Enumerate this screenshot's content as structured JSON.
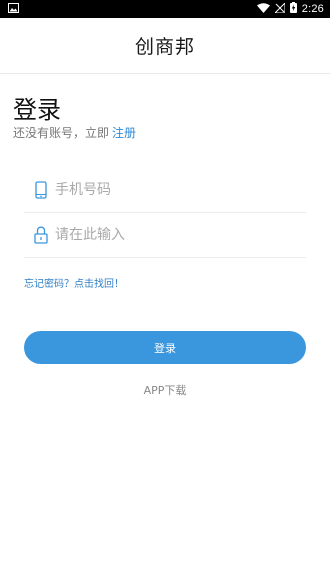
{
  "status_bar": {
    "time": "2:26",
    "icons": [
      "image-icon",
      "wifi-icon",
      "no-signal-icon",
      "battery-charging-icon"
    ]
  },
  "header": {
    "title": "创商邦"
  },
  "login": {
    "heading": "登录",
    "no_account_text": "还没有账号，立即",
    "register_link": "注册"
  },
  "form": {
    "phone": {
      "placeholder": "手机号码",
      "value": "",
      "icon": "phone-icon"
    },
    "code": {
      "placeholder": "请在此输入",
      "value": "",
      "icon": "lock-icon"
    },
    "forgot_password": "忘记密码？点击找回！",
    "submit_label": "登录"
  },
  "footer": {
    "download_label": "APP下载"
  },
  "colors": {
    "accent": "#3a96dd",
    "link": "#2f8bd8",
    "status_bar": "#000000"
  }
}
